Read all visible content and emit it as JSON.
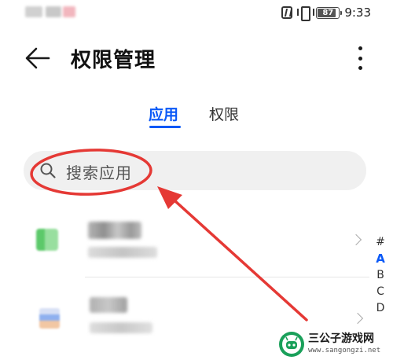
{
  "status_bar": {
    "battery_level": "87",
    "time": "9:33",
    "icons": [
      "nfc-icon",
      "vibrate-icon",
      "battery-icon"
    ]
  },
  "header": {
    "back_icon": "arrow-left-icon",
    "title": "权限管理",
    "more_icon": "more-vertical-icon"
  },
  "tabs": [
    {
      "label": "应用",
      "active": true
    },
    {
      "label": "权限",
      "active": false
    }
  ],
  "search": {
    "icon": "search-icon",
    "placeholder": "搜索应用"
  },
  "alphabet_index": [
    "#",
    "A",
    "B",
    "C",
    "D"
  ],
  "alphabet_active": "A",
  "colors": {
    "accent": "#0a59f7",
    "annotation": "#e53935",
    "search_bg": "#f0f0f0"
  },
  "watermark": {
    "title": "三公子游戏网",
    "url": "www.sangongzi.net"
  }
}
